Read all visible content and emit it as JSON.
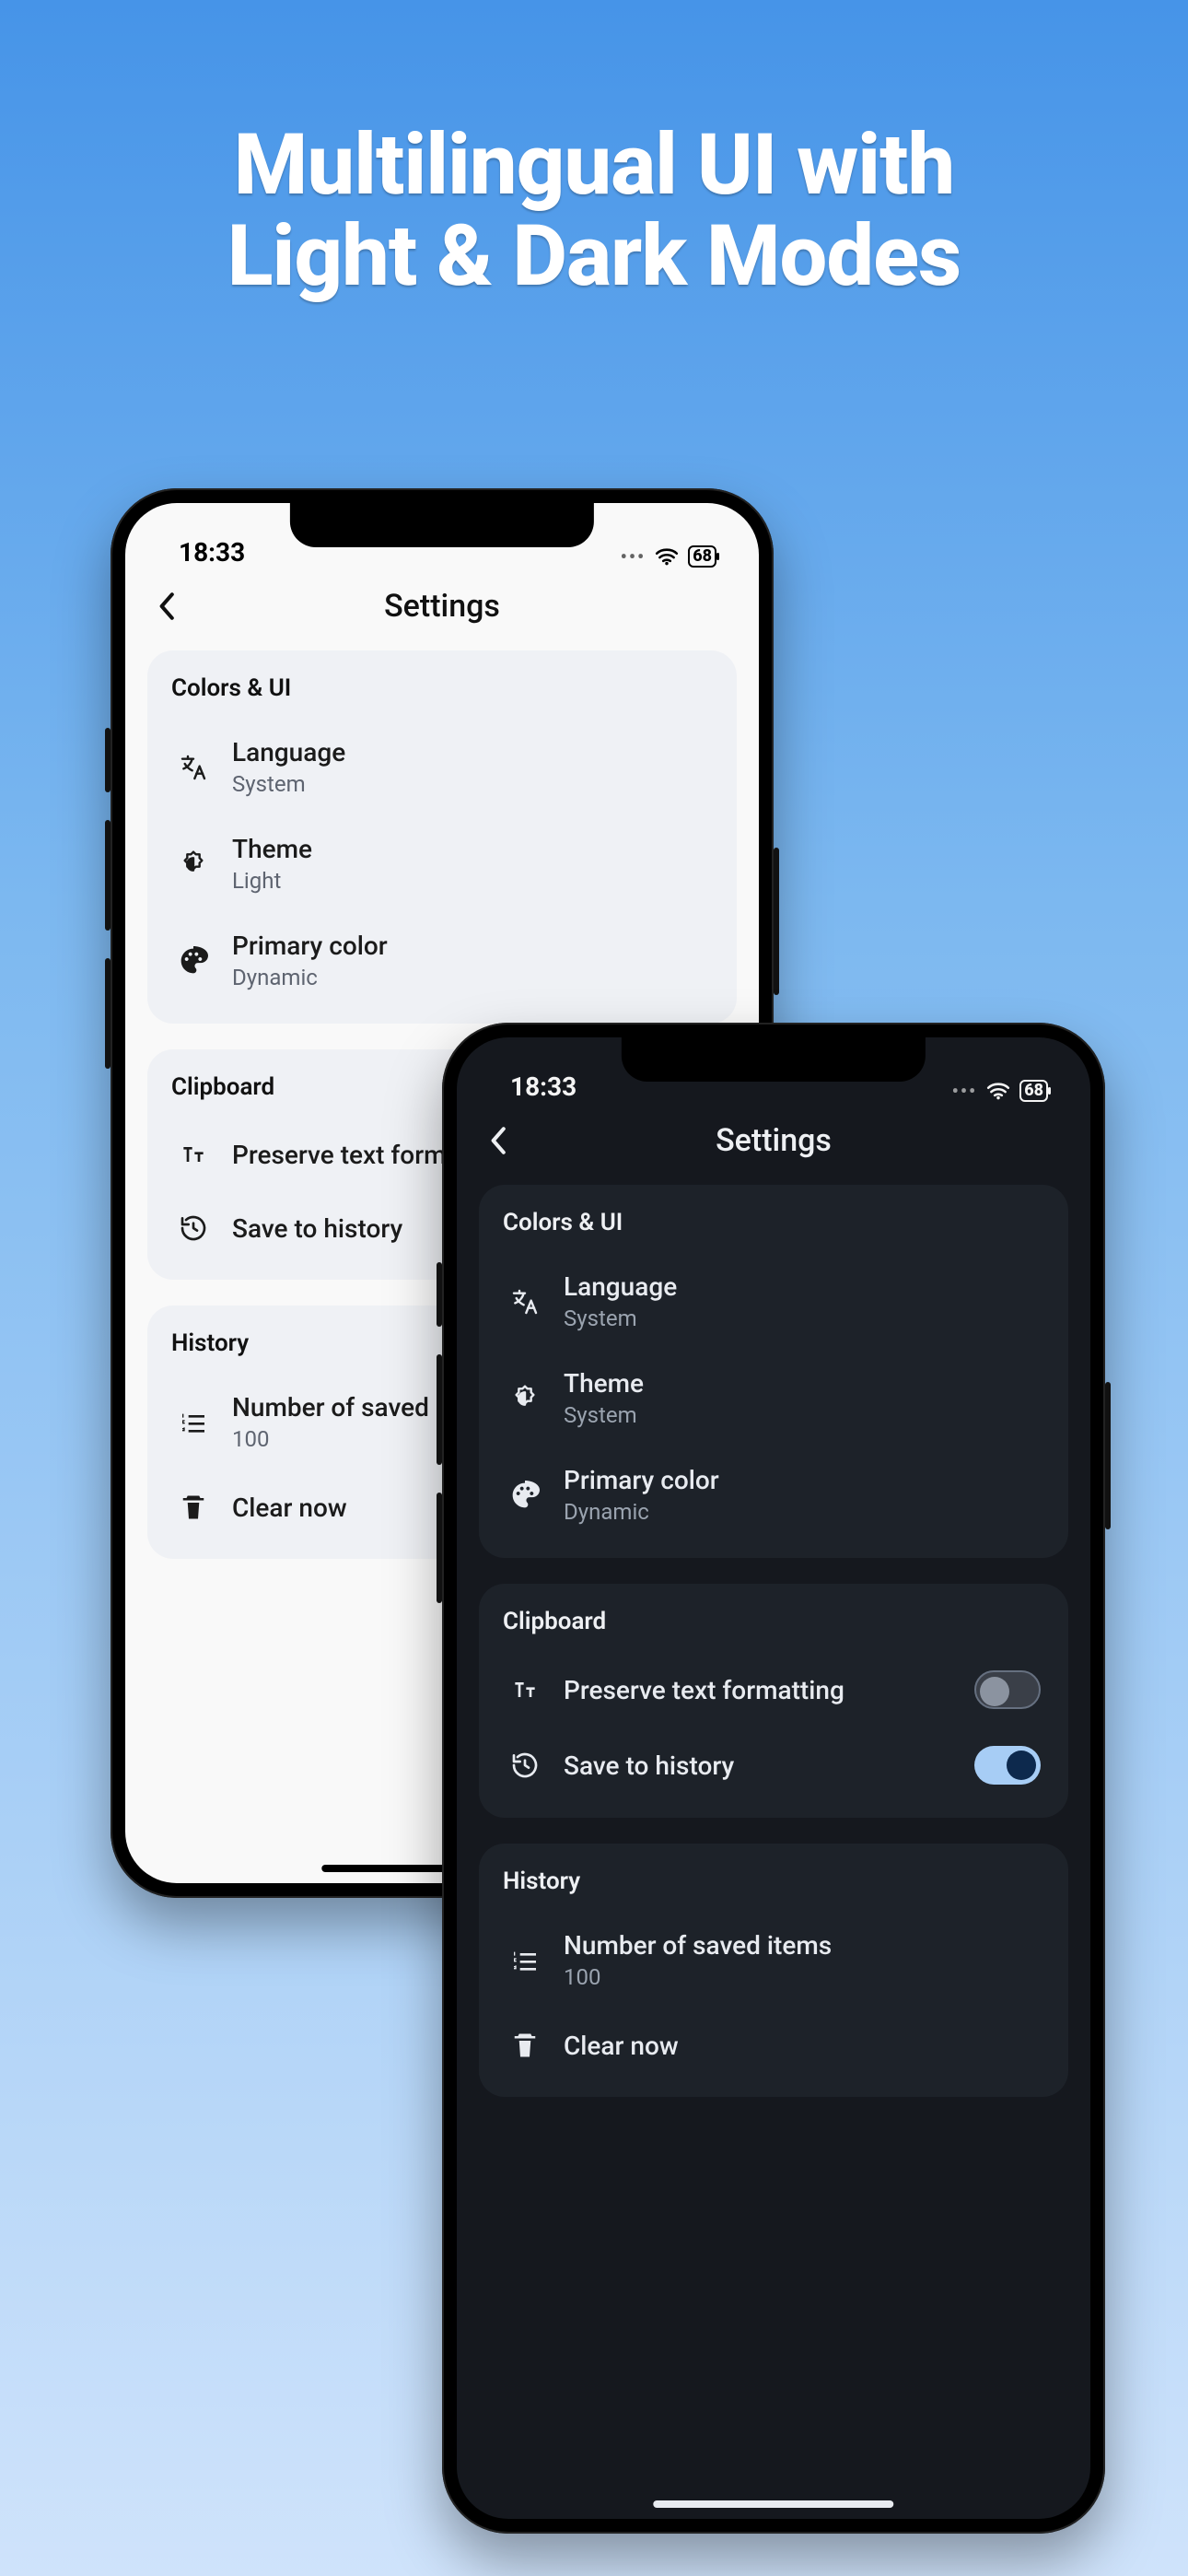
{
  "promo": {
    "title_line1": "Multilingual UI with",
    "title_line2": "Light & Dark Modes"
  },
  "status": {
    "time": "18:33",
    "battery": "68"
  },
  "nav_title": "Settings",
  "sections": {
    "colors_ui": {
      "title": "Colors & UI",
      "language_label": "Language",
      "language_value_light": "System",
      "language_value_dark": "System",
      "theme_label": "Theme",
      "theme_value_light": "Light",
      "theme_value_dark": "System",
      "primary_label": "Primary color",
      "primary_value": "Dynamic"
    },
    "clipboard": {
      "title": "Clipboard",
      "preserve_label": "Preserve text formatting",
      "save_history_label": "Save to history",
      "preserve_on": false,
      "save_on": true
    },
    "history": {
      "title": "History",
      "count_label": "Number of saved items",
      "count_value": "100",
      "clear_label": "Clear now"
    }
  }
}
